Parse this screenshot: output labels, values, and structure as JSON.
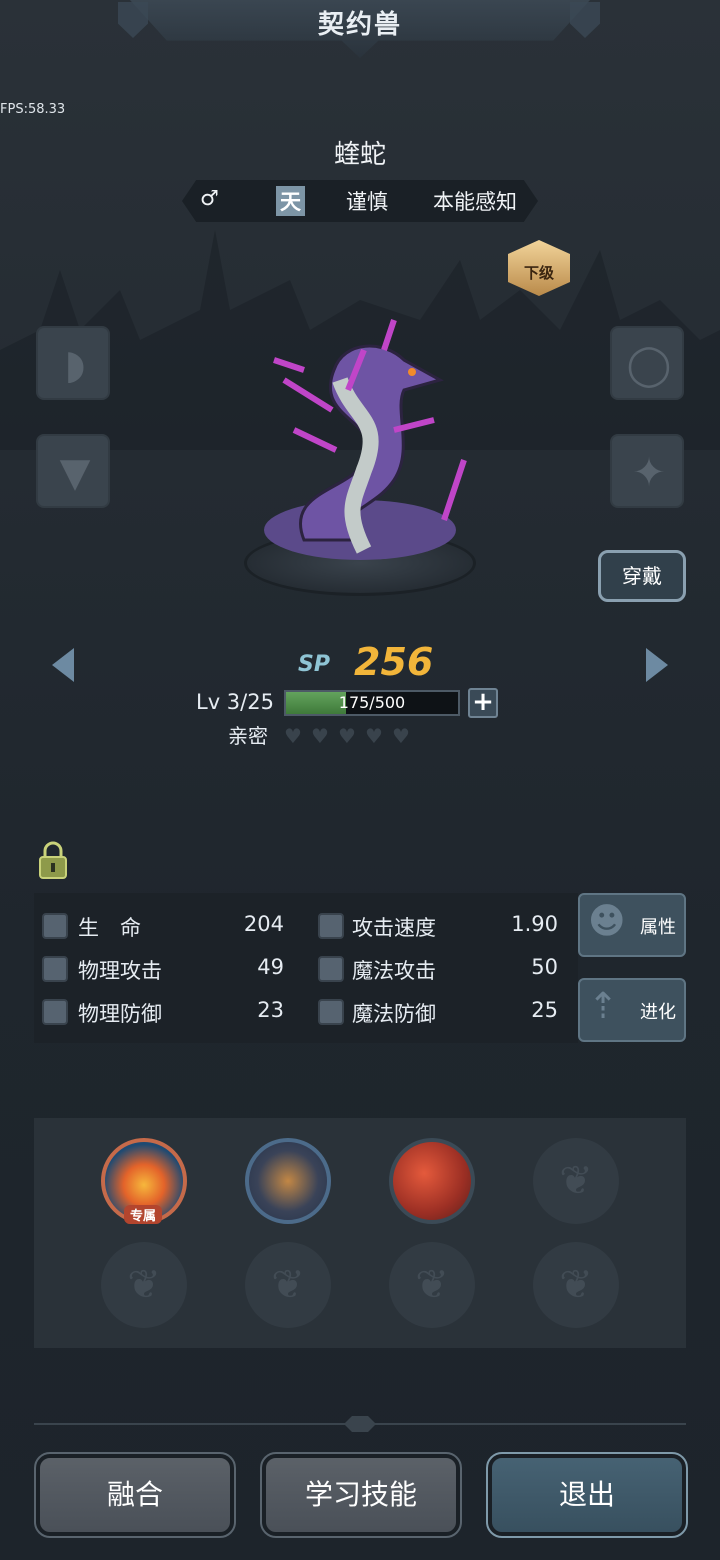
{
  "header": {
    "title": "契约兽"
  },
  "fps": "FPS:58.33",
  "pet": {
    "name": "蝰蛇",
    "gender_icon": "♂",
    "element": "天",
    "trait_1": "谨慎",
    "trait_2": "本能感知",
    "grade": "下级"
  },
  "equip_button": "穿戴",
  "sp": {
    "label": "SP",
    "value": "256"
  },
  "level": {
    "text": "Lv 3/25",
    "xp_text": "175/500",
    "xp_fraction": 0.35
  },
  "affinity": {
    "label": "亲密",
    "hearts_total": 5,
    "hearts_filled": 0
  },
  "stats": [
    {
      "label": "生　命",
      "value": "204"
    },
    {
      "label": "攻击速度",
      "value": "1.90"
    },
    {
      "label": "物理攻击",
      "value": "49"
    },
    {
      "label": "魔法攻击",
      "value": "50"
    },
    {
      "label": "物理防御",
      "value": "23"
    },
    {
      "label": "魔法防御",
      "value": "25"
    }
  ],
  "side_buttons": {
    "attributes": "属性",
    "evolve": "进化"
  },
  "skills": {
    "exclusive_tag": "专属"
  },
  "bottom_buttons": {
    "fuse": "融合",
    "learn": "学习技能",
    "exit": "退出"
  },
  "colors": {
    "sp": "#f2b53a",
    "xp_fill": "#4f8f49",
    "panel": "#1c2228",
    "accent_blue": "#466273"
  }
}
